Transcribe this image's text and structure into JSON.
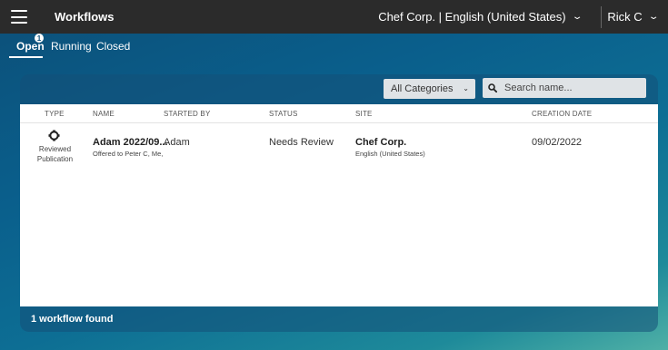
{
  "topbar": {
    "title": "Workflows",
    "site_selector": "Chef Corp. | English (United States)",
    "user": "Rick C"
  },
  "tabs": [
    {
      "label": "Open",
      "badge": "1",
      "active": true
    },
    {
      "label": "Running"
    },
    {
      "label": "Closed"
    }
  ],
  "filters": {
    "category": "All Categories",
    "search_placeholder": "Search name..."
  },
  "table": {
    "columns": [
      "TYPE",
      "NAME",
      "STARTED BY",
      "STATUS",
      "SITE",
      "CREATION DATE"
    ],
    "rows": [
      {
        "type_line1": "Reviewed",
        "type_line2": "Publication",
        "name": "Adam 2022/09...",
        "name_sub": "Offered to Peter C, Me,",
        "started_by": "Adam",
        "status": "Needs Review",
        "site": "Chef Corp.",
        "site_sub": "English (United States)",
        "creation_date": "09/02/2022"
      }
    ]
  },
  "footer": {
    "count_text": "1 workflow found"
  }
}
